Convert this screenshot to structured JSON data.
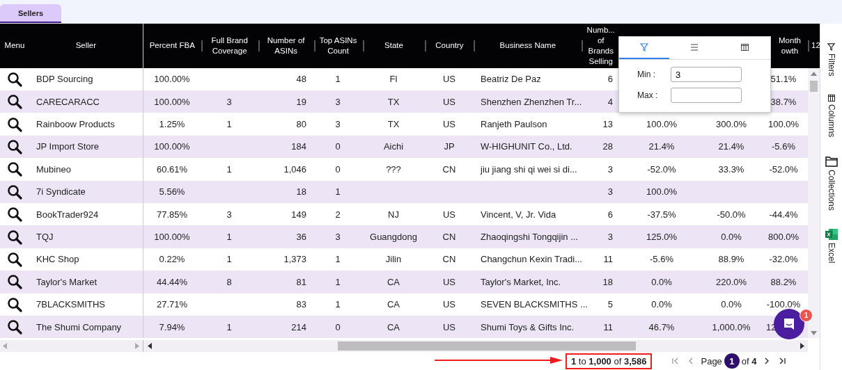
{
  "tabs": [
    {
      "label": "Sellers",
      "selected": true
    }
  ],
  "table": {
    "columns": [
      {
        "lines": [
          "Menu"
        ]
      },
      {
        "lines": [
          "Seller"
        ]
      },
      {
        "lines": [
          "Percent FBA"
        ]
      },
      {
        "lines": [
          "Full Brand",
          "Coverage"
        ]
      },
      {
        "lines": [
          "Number of",
          "ASINs"
        ]
      },
      {
        "lines": [
          "Top ASINs",
          "Count"
        ]
      },
      {
        "lines": [
          "State"
        ]
      },
      {
        "lines": [
          "Country"
        ]
      },
      {
        "lines": [
          "Business Name"
        ]
      },
      {
        "lines": [
          "Numb...",
          "of",
          "Brands",
          "Selling"
        ]
      },
      {},
      {},
      {
        "lines": [
          "Month",
          "owth"
        ]
      },
      {
        "lines": [
          "12"
        ]
      }
    ],
    "rows": [
      {
        "cells": [
          null,
          "BDP Sourcing",
          "100.00%",
          null,
          "48",
          "1",
          "Fl",
          "US",
          "Beatriz De Paz",
          "6",
          null,
          null,
          "51.1%"
        ]
      },
      {
        "cells": [
          null,
          "CARECARACC",
          "100.00%",
          "3",
          "19",
          "3",
          "TX",
          "US",
          "Shenzhen Zhenzhen Tr...",
          "4",
          null,
          null,
          "38.7%"
        ]
      },
      {
        "cells": [
          null,
          "Rainboow Products",
          "1.25%",
          "1",
          "80",
          "3",
          "TX",
          "US",
          "Ranjeth Paulson",
          "13",
          "100.0%",
          "300.0%",
          "100.0%"
        ]
      },
      {
        "cells": [
          null,
          "JP Import Store",
          "100.00%",
          null,
          "184",
          "0",
          "Aichi",
          "JP",
          "W-HIGHUNIT Co., Ltd.",
          "28",
          "21.4%",
          "21.4%",
          "-5.6%"
        ]
      },
      {
        "cells": [
          null,
          "Mubineo",
          "60.61%",
          "1",
          "1,046",
          "0",
          "???",
          "CN",
          "jiu jiang shi qi wei si di...",
          "3",
          "-52.0%",
          "33.3%",
          "-52.0%"
        ]
      },
      {
        "cells": [
          null,
          "7i Syndicate",
          "5.56%",
          null,
          "18",
          "1",
          null,
          null,
          null,
          "3",
          "100.0%",
          null,
          null
        ]
      },
      {
        "cells": [
          null,
          "BookTrader924",
          "77.85%",
          "3",
          "149",
          "2",
          "NJ",
          "US",
          "Vincent, V, Jr. Vida",
          "6",
          "-37.5%",
          "-50.0%",
          "-44.4%"
        ]
      },
      {
        "cells": [
          null,
          "TQJ",
          "100.00%",
          "1",
          "36",
          "3",
          "Guangdong",
          "CN",
          "Zhaoqingshi Tongqijin ...",
          "3",
          "125.0%",
          "0.0%",
          "800.0%"
        ]
      },
      {
        "cells": [
          null,
          "KHC Shop",
          "0.22%",
          "1",
          "1,373",
          "1",
          "Jilin",
          "CN",
          "Changchun Kexin Tradi...",
          "11",
          "-5.6%",
          "88.9%",
          "-32.0%"
        ]
      },
      {
        "cells": [
          null,
          "Taylor's Market",
          "44.44%",
          "8",
          "81",
          "1",
          "CA",
          "US",
          "Taylor's Market, Inc.",
          "18",
          "0.0%",
          "220.0%",
          "88.2%"
        ]
      },
      {
        "cells": [
          null,
          "7BLACKSMITHS",
          "27.71%",
          null,
          "83",
          "1",
          "CA",
          "US",
          "SEVEN BLACKSMITHS ...",
          "5",
          "0.0%",
          "0.0%",
          "-100.0%"
        ]
      },
      {
        "cells": [
          null,
          "The Shumi Company",
          "7.94%",
          "1",
          "214",
          "0",
          "CA",
          "US",
          "Shumi Toys & Gifts Inc.",
          "11",
          "46.7%",
          "1,000.0%",
          "12"
        ]
      }
    ]
  },
  "filter_popup": {
    "tabs": [
      {
        "kind": "filter",
        "selected": true
      },
      {
        "kind": "menu",
        "selected": false
      },
      {
        "kind": "columns",
        "selected": false
      }
    ],
    "fields": [
      {
        "label": "Min :",
        "value": "3"
      },
      {
        "label": "Max :"
      }
    ]
  },
  "side_panel": [
    {
      "kind": "filter",
      "label": "Filters"
    },
    {
      "kind": "columns",
      "label": "Columns"
    },
    {
      "kind": "folder",
      "label": "Collections"
    },
    {
      "kind": "excel",
      "label": "Excel"
    }
  ],
  "chat": {
    "badge": "1"
  },
  "pagination": {
    "range": "**1** to **1,000** of **3,586**",
    "page_label": "Page",
    "page": "1",
    "of": "of **4**"
  }
}
